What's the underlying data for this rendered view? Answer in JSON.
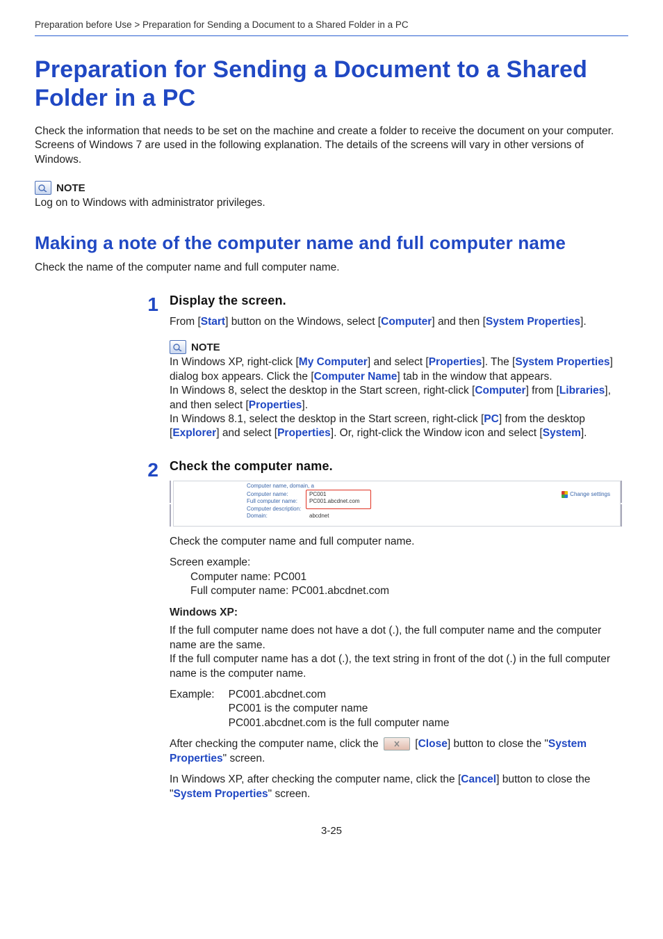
{
  "breadcrumb": "Preparation before Use > Preparation for Sending a Document to a Shared Folder in a PC",
  "title": "Preparation for Sending a Document to a Shared Folder in a PC",
  "intro": "Check the information that needs to be set on the machine and create a folder to receive the document on your computer. Screens of Windows 7 are used in the following explanation. The details of the screens will vary in other versions of Windows.",
  "note1": {
    "label": "NOTE",
    "text": "Log on to Windows with administrator privileges."
  },
  "section_title": "Making a note of the computer name and full computer name",
  "section_intro": "Check the name of the computer name and full computer name.",
  "step1": {
    "num": "1",
    "heading": "Display the screen.",
    "t_from": "From [",
    "t_start": "Start",
    "t_mid1": "] button on the Windows, select [",
    "t_computer": "Computer",
    "t_mid2": "] and then [",
    "t_sysprop": "System Properties",
    "t_end": "].",
    "note": {
      "label": "NOTE",
      "xp_a": "In Windows XP, right-click [",
      "xp_mycomp": "My Computer",
      "xp_b": "] and select [",
      "xp_props": "Properties",
      "xp_c": "]. The [",
      "xp_sysprop": "System Properties",
      "xp_d": "] dialog box appears. Click the [",
      "xp_compname": "Computer Name",
      "xp_e": "] tab in the window that appears.",
      "w8_a": "In Windows 8, select the desktop in the Start screen, right-click [",
      "w8_computer": "Computer",
      "w8_b": "] from [",
      "w8_libraries": "Libraries",
      "w8_c": "], and then select [",
      "w8_props": "Properties",
      "w8_d": "].",
      "w81_a": "In Windows 8.1, select the desktop in the Start screen, right-click [",
      "w81_pc": "PC",
      "w81_b": "] from the desktop [",
      "w81_explorer": "Explorer",
      "w81_c": "] and select [",
      "w81_props": "Properties",
      "w81_d": "]. Or, right-click the Window icon and select [",
      "w81_system": "System",
      "w81_e": "]."
    }
  },
  "step2": {
    "num": "2",
    "heading": "Check the computer name.",
    "shot": {
      "group_label": "Computer name, domain, a",
      "row1_lbl": "Computer name:",
      "row1_val": "PC001",
      "row2_lbl": "Full computer name:",
      "row2_val": "PC001.abcdnet.com",
      "row3_lbl": "Computer description:",
      "row3_val": "",
      "row4_lbl": "Domain:",
      "row4_val": "abcdnet",
      "change": "Change settings"
    },
    "after_shot": "Check the computer name and full computer name.",
    "screen_example_label": "Screen example:",
    "ex_cn": "Computer name: PC001",
    "ex_fcn": "Full computer name: PC001.abcdnet.com",
    "winxp_heading": "Windows XP:",
    "xp1": "If the full computer name does not have a dot (.), the full computer name and the computer name are the same.",
    "xp2": "If the full computer name has a dot (.), the text string in front of the dot (.) in the full computer name is the computer name.",
    "example_label": "Example:",
    "example_line1": "PC001.abcdnet.com",
    "example_line2": "PC001 is the computer name",
    "example_line3": "PC001.abcdnet.com is the full computer name",
    "close_a": "After checking the computer name, click the ",
    "close_b": " [",
    "close_btn": "Close",
    "close_c": "] button to close the \"",
    "close_sys": "System Properties",
    "close_d": "\" screen.",
    "xp_close_a": "In Windows XP, after checking the computer name, click the [",
    "xp_close_cancel": "Cancel",
    "xp_close_b": "] button to close the \"",
    "xp_close_sys": "System Properties",
    "xp_close_c": "\" screen."
  },
  "page_num": "3-25"
}
